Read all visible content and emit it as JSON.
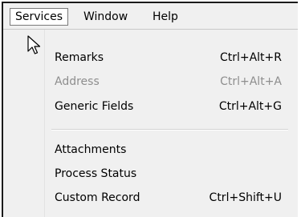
{
  "menubar": {
    "items": [
      {
        "label": "Services"
      },
      {
        "label": "Window"
      },
      {
        "label": "Help"
      }
    ]
  },
  "dropdown": {
    "items": [
      {
        "label": "Remarks",
        "shortcut": "Ctrl+Alt+R",
        "enabled": true
      },
      {
        "label": "Address",
        "shortcut": "Ctrl+Alt+A",
        "enabled": false
      },
      {
        "label": "Generic Fields",
        "shortcut": "Ctrl+Alt+G",
        "enabled": true
      },
      {
        "label": "Attachments",
        "shortcut": "",
        "enabled": true
      },
      {
        "label": "Process Status",
        "shortcut": "",
        "enabled": true
      },
      {
        "label": "Custom Record",
        "shortcut": "Ctrl+Shift+U",
        "enabled": true
      }
    ]
  },
  "cursor": {
    "icon": "arrow-pointer-icon"
  },
  "colors": {
    "menu_bg": "#f0f0f0",
    "disabled_text": "#8e8e8e",
    "active_border": "#7a7a7a"
  }
}
